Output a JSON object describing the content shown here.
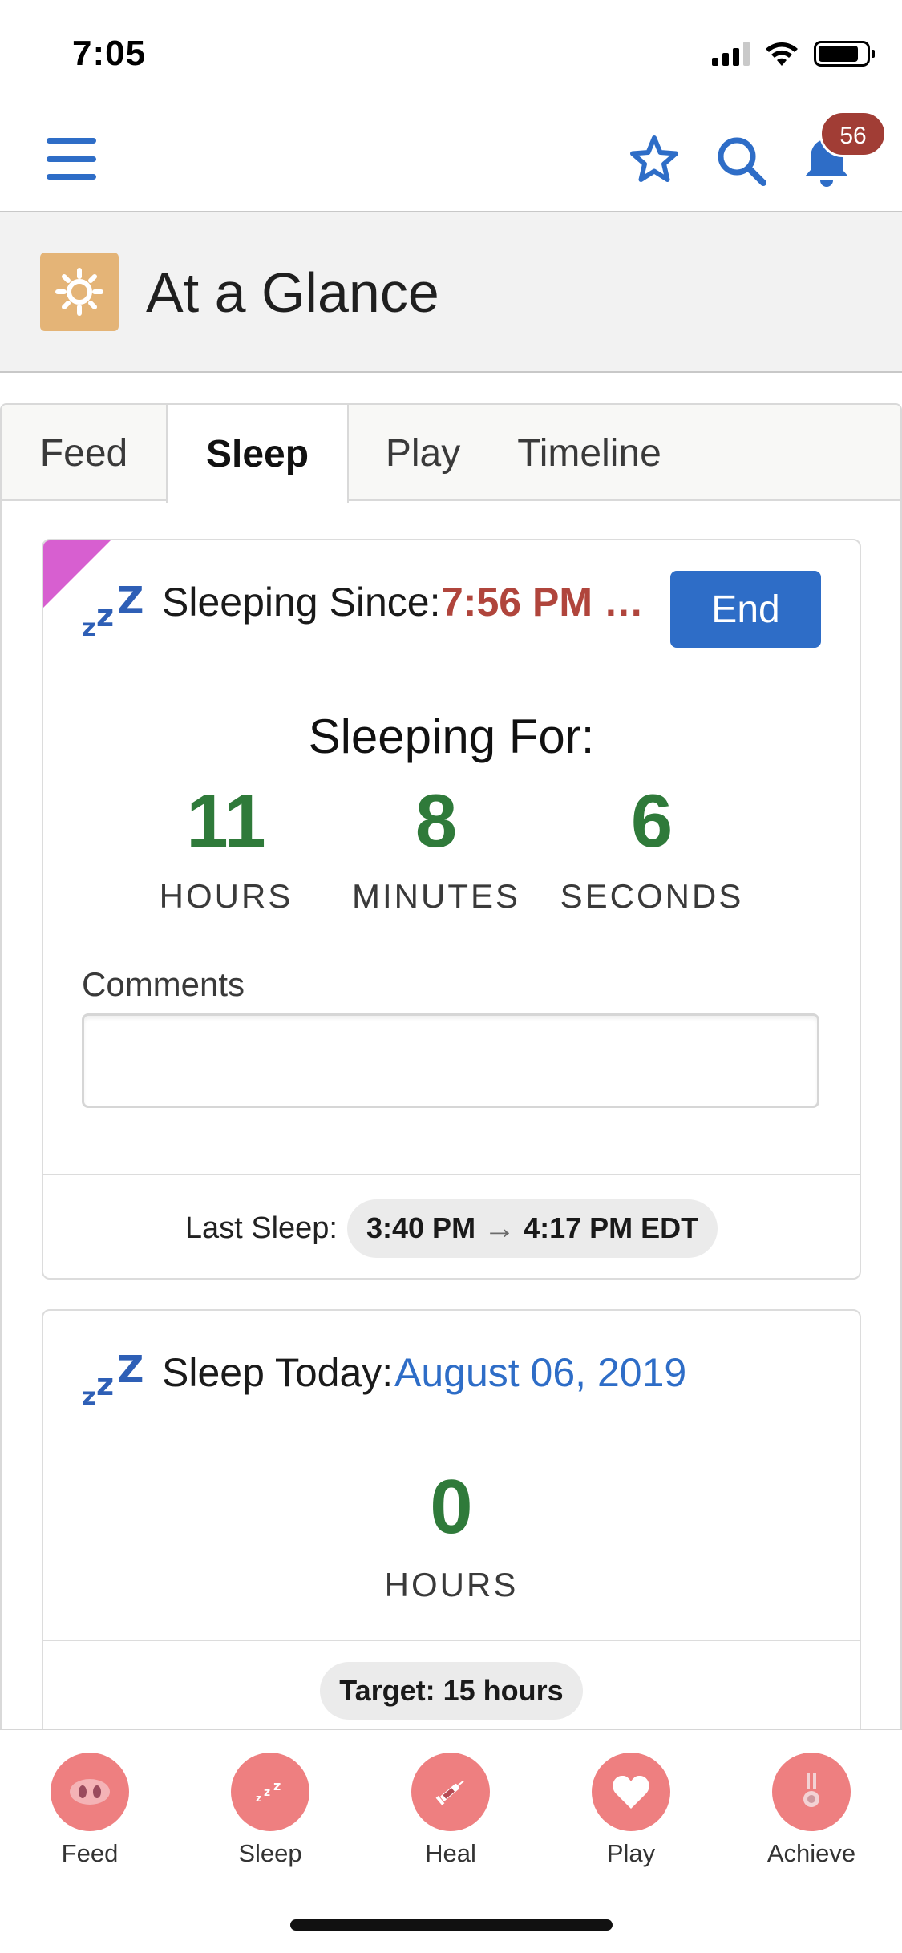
{
  "status_bar": {
    "time": "7:05"
  },
  "nav": {
    "notifications_count": "56"
  },
  "header": {
    "title": "At a Glance"
  },
  "tabs": [
    {
      "label": "Feed"
    },
    {
      "label": "Sleep"
    },
    {
      "label": "Play"
    },
    {
      "label": "Timeline"
    }
  ],
  "active_tab": "Sleep",
  "sleep_card": {
    "since_label": "Sleeping Since:",
    "since_value": "7:56 PM …",
    "end_label": "End",
    "for_title": "Sleeping For:",
    "hours_value": "11",
    "hours_label": "HOURS",
    "minutes_value": "8",
    "minutes_label": "MINUTES",
    "seconds_value": "6",
    "seconds_label": "SECONDS",
    "comments_label": "Comments",
    "comments_value": "",
    "last_sleep_label": "Last Sleep:",
    "last_sleep_start": "3:40 PM",
    "last_sleep_end": "4:17 PM EDT"
  },
  "today_card": {
    "label": "Sleep Today:",
    "date": "August 06, 2019",
    "hours_value": "0",
    "hours_label": "HOURS",
    "target": "Target: 15 hours"
  },
  "bottom_nav": [
    {
      "label": "Feed",
      "icon": "pig-nose-icon"
    },
    {
      "label": "Sleep",
      "icon": "zzz-icon"
    },
    {
      "label": "Heal",
      "icon": "syringe-icon"
    },
    {
      "label": "Play",
      "icon": "heart-icon"
    },
    {
      "label": "Achieve",
      "icon": "medal-icon"
    }
  ],
  "colors": {
    "brand_blue": "#2e6dc7",
    "accent_red": "#b0453c",
    "counter_green": "#2f7a3a",
    "bottom_icon_bg": "#ee7f80",
    "header_icon_bg": "#e4b477",
    "corner_flag": "#d75fd0"
  }
}
